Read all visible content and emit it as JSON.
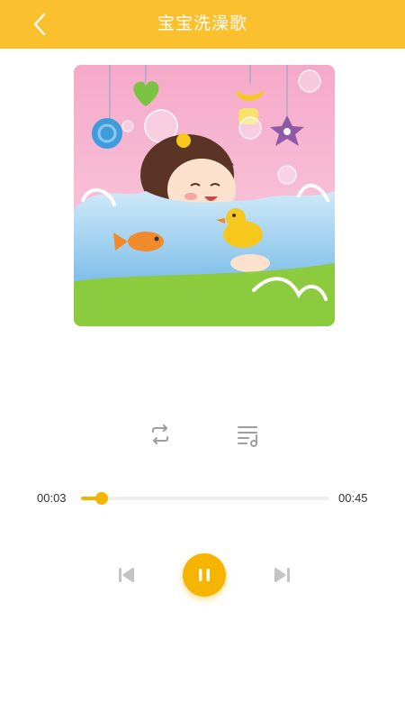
{
  "header": {
    "title": "宝宝洗澡歌",
    "back_icon": "chevron-left-icon"
  },
  "player": {
    "current_time": "00:03",
    "total_time": "00:45",
    "progress": 0.085,
    "state": "playing"
  },
  "controls": {
    "mode_icon": "repeat-icon",
    "playlist_icon": "playlist-icon",
    "prev_icon": "skip-previous-icon",
    "play_pause_icon": "pause-icon",
    "next_icon": "skip-next-icon"
  },
  "colors": {
    "header_bg": "#FBC02D",
    "accent": "#F4B400",
    "icon_gray": "#BDBDBD",
    "track": "#EEEEEE"
  }
}
